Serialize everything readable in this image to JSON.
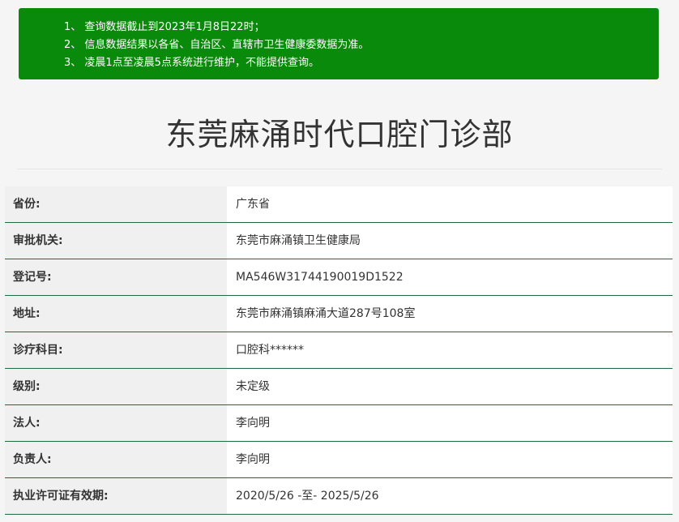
{
  "notice": {
    "lines": [
      "1、 查询数据截止到2023年1月8日22时；",
      "2、 信息数据结果以各省、自治区、直辖市卫生健康委数据为准。",
      "3、 凌晨1点至凌晨5点系统进行维护，不能提供查询。"
    ],
    "background_color": "#0a8a0a"
  },
  "page_title": "东莞麻涌时代口腔门诊部",
  "details": [
    {
      "label": "省份:",
      "value": "广东省"
    },
    {
      "label": "审批机关:",
      "value": "东莞市麻涌镇卫生健康局"
    },
    {
      "label": "登记号:",
      "value": "MA546W31744190019D1522"
    },
    {
      "label": "地址:",
      "value": "东莞市麻涌镇麻涌大道287号108室"
    },
    {
      "label": "诊疗科目:",
      "value": "口腔科******"
    },
    {
      "label": "级别:",
      "value": "未定级"
    },
    {
      "label": "法人:",
      "value": "李向明"
    },
    {
      "label": "负责人:",
      "value": "李向明"
    },
    {
      "label": "执业许可证有效期:",
      "value": "2020/5/26 -至- 2025/5/26"
    }
  ],
  "row_border_color": "#1f6b3a"
}
